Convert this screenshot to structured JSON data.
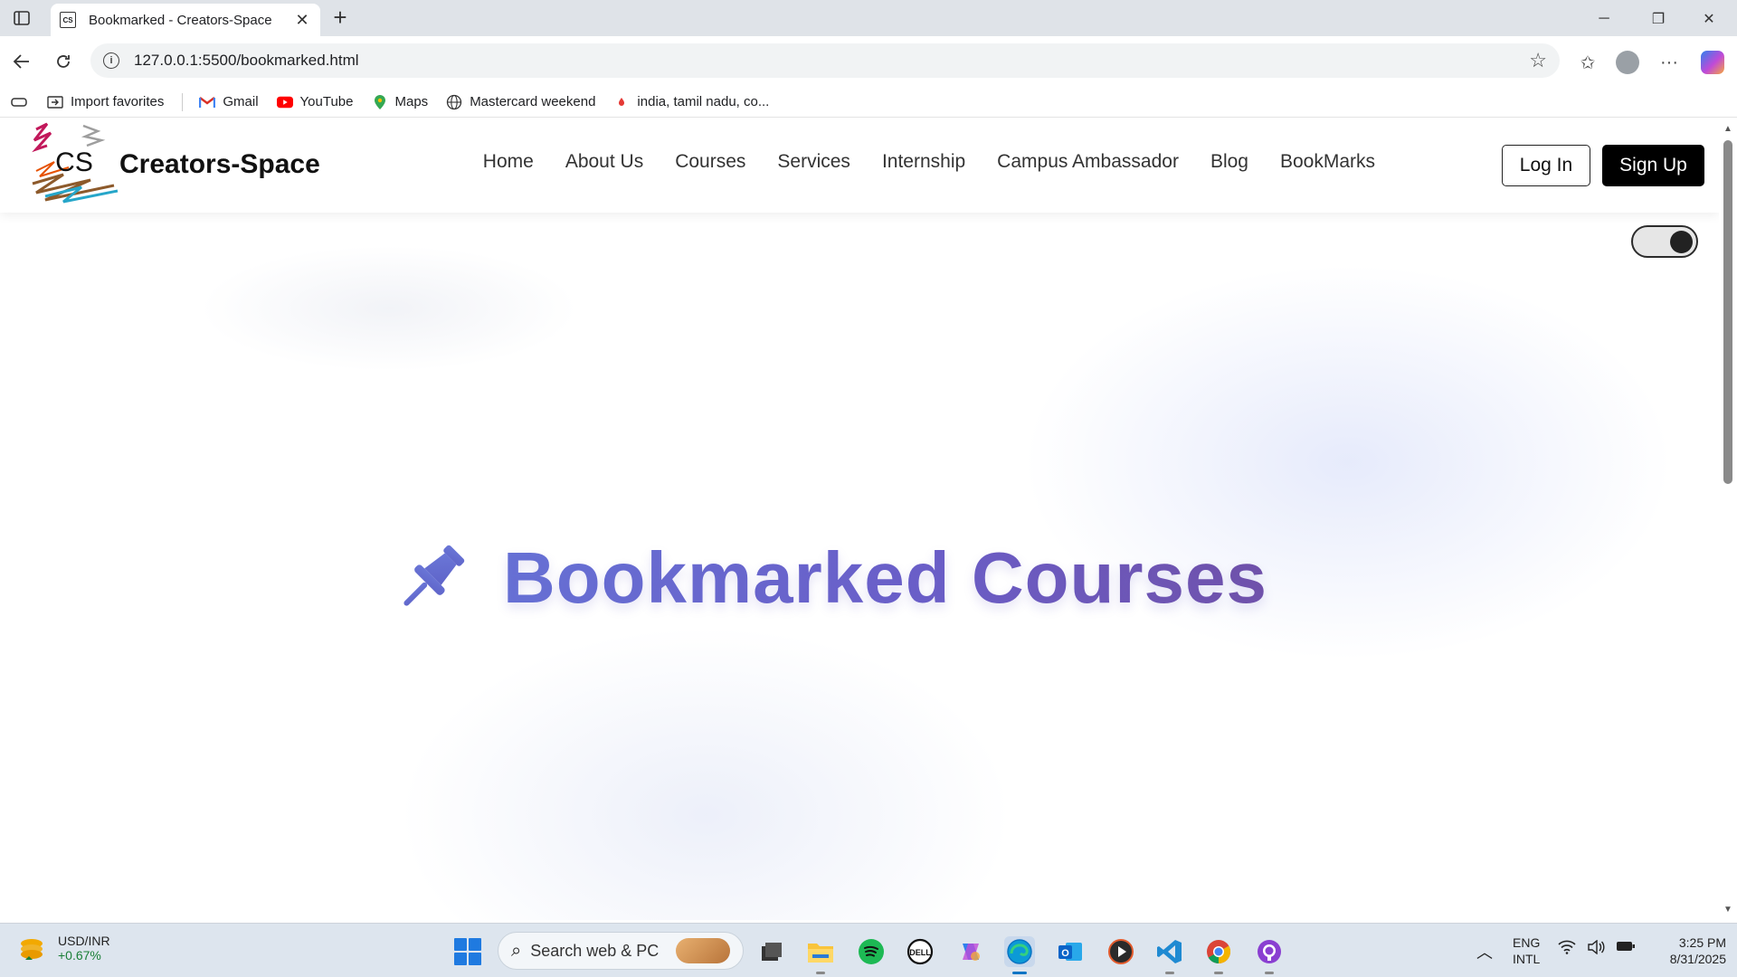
{
  "browser": {
    "tab_title": "Bookmarked - Creators-Space",
    "tab_favicon_text": "CS",
    "url": "127.0.0.1:5500/bookmarked.html"
  },
  "bookmarks_bar": [
    {
      "label": "Import favorites",
      "icon": "import-icon"
    },
    {
      "label": "Gmail",
      "icon": "gmail-icon"
    },
    {
      "label": "YouTube",
      "icon": "youtube-icon"
    },
    {
      "label": "Maps",
      "icon": "maps-icon"
    },
    {
      "label": "Mastercard weekend",
      "icon": "globe-icon"
    },
    {
      "label": "india, tamil nadu, co...",
      "icon": "pin-dot-icon"
    }
  ],
  "site": {
    "logo_mark": "CS",
    "logo_text": "Creators-Space",
    "nav": [
      "Home",
      "About Us",
      "Courses",
      "Services",
      "Internship",
      "Campus Ambassador",
      "Blog",
      "BookMarks"
    ],
    "login_label": "Log In",
    "signup_label": "Sign Up",
    "theme_toggle_state": "dark"
  },
  "hero": {
    "icon": "pushpin-icon",
    "title": "Bookmarked Courses"
  },
  "taskbar": {
    "widget_name": "USD/INR",
    "widget_value": "+0.67%",
    "search_placeholder": "Search web & PC",
    "lang_1": "ENG",
    "lang_2": "INTL",
    "time": "3:25 PM",
    "date": "8/31/2025",
    "apps": [
      "task-view",
      "file-explorer",
      "spotify",
      "dell",
      "copilot",
      "edge",
      "outlook",
      "media-player",
      "vscode",
      "chrome",
      "github-desktop"
    ]
  },
  "colors": {
    "hero_gradient_start": "#6672d6",
    "hero_gradient_end": "#7050a8",
    "pin_color": "#6672d6",
    "signup_bg": "#000000"
  }
}
